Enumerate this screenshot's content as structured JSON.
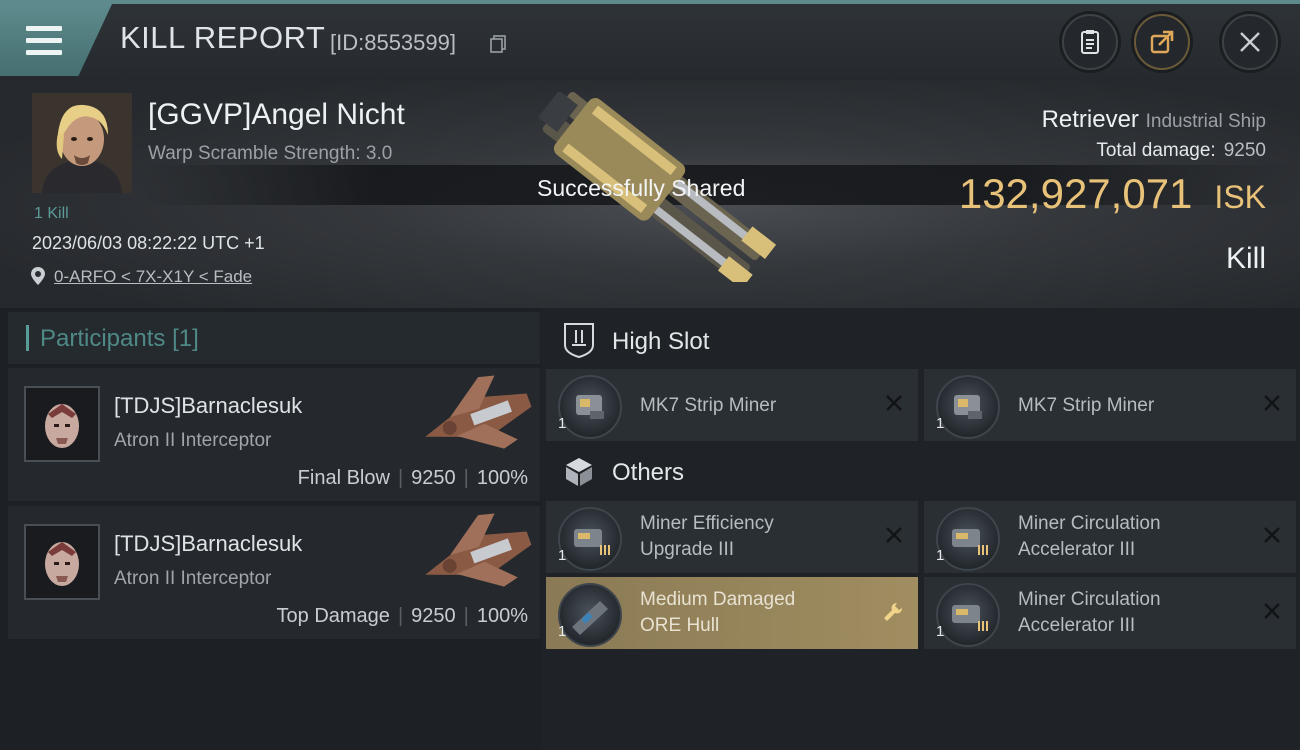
{
  "header": {
    "title": "KILL REPORT",
    "report_id": "[ID:8553599]",
    "icons": [
      "menu-icon",
      "copy-icon",
      "clipboard-icon",
      "share-icon",
      "close-icon"
    ]
  },
  "victim": {
    "name": "[GGVP]Angel Nicht",
    "warp_scramble": "Warp Scramble Strength: 3.0",
    "kills": "1 Kill",
    "datetime": "2023/06/03 08:22:22 UTC +1",
    "location": "0-ARFO < 7X-X1Y < Fade"
  },
  "ship": {
    "name": "Retriever",
    "class": "Industrial Ship",
    "damage_label": "Total damage:",
    "damage_value": "9250",
    "isk_value": "132,927,071",
    "isk_unit": "ISK",
    "result": "Kill"
  },
  "toast": "Successfully Shared",
  "participants": {
    "title": "Participants",
    "count": "[1]",
    "items": [
      {
        "name": "[TDJS]Barnaclesuk",
        "ship": "Atron II Interceptor",
        "role": "Final Blow",
        "damage": "9250",
        "percent": "100%"
      },
      {
        "name": "[TDJS]Barnaclesuk",
        "ship": "Atron II Interceptor",
        "role": "Top Damage",
        "damage": "9250",
        "percent": "100%"
      }
    ]
  },
  "modules": {
    "high_slot_title": "High Slot",
    "others_title": "Others",
    "high_slot": [
      {
        "qty": "1",
        "line1": "MK7 Strip Miner",
        "line2": ""
      },
      {
        "qty": "1",
        "line1": "MK7 Strip Miner",
        "line2": ""
      }
    ],
    "others": [
      {
        "qty": "1",
        "line1": "Miner Efficiency",
        "line2": "Upgrade III"
      },
      {
        "qty": "1",
        "line1": "Miner Circulation",
        "line2": "Accelerator III"
      },
      {
        "qty": "1",
        "line1": "Medium Damaged",
        "line2": "ORE Hull"
      },
      {
        "qty": "1",
        "line1": "Miner Circulation",
        "line2": "Accelerator III"
      }
    ]
  },
  "colors": {
    "accent_teal": "#5d8a8c",
    "isk_gold": "#e9c27a",
    "highlight_row": "#a08d60"
  }
}
